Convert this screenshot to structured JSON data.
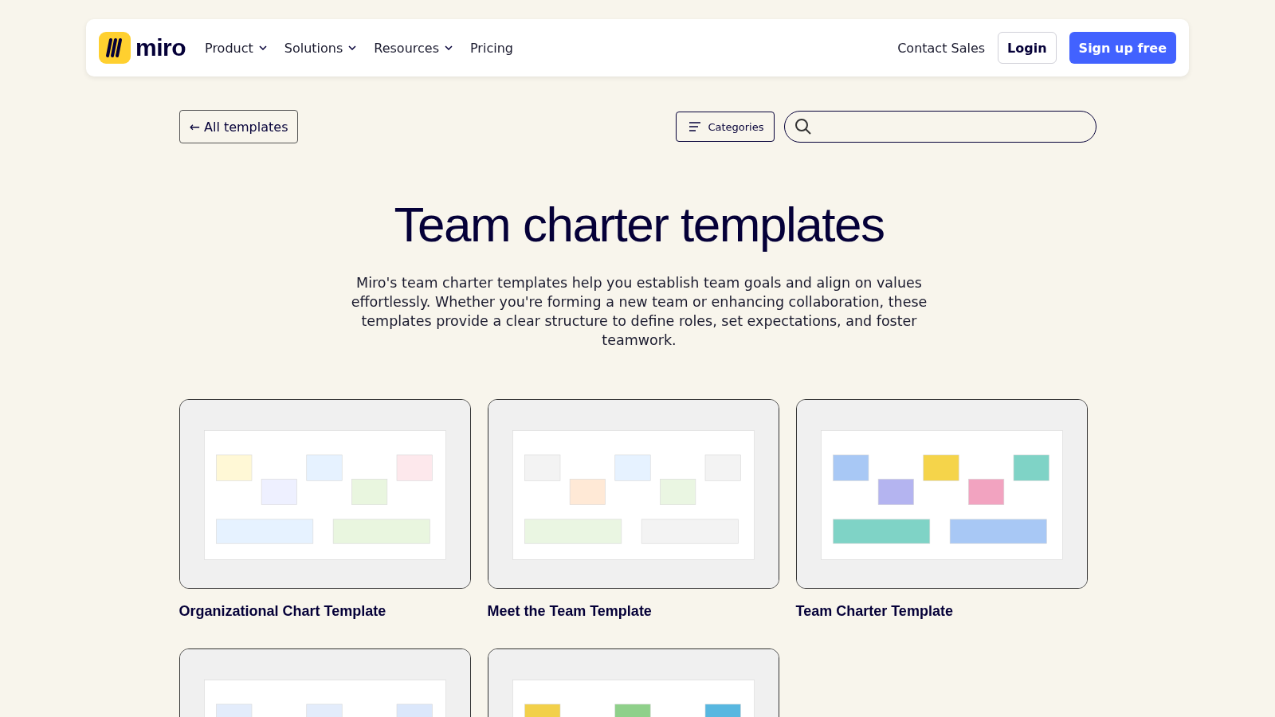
{
  "header": {
    "logo": "miro",
    "nav": [
      {
        "label": "Product",
        "has_menu": true
      },
      {
        "label": "Solutions",
        "has_menu": true
      },
      {
        "label": "Resources",
        "has_menu": true
      },
      {
        "label": "Pricing",
        "has_menu": false
      }
    ],
    "contact": "Contact Sales",
    "login": "Login",
    "signup": "Sign up free"
  },
  "toolbar": {
    "back": "← All templates",
    "categories": "Categories"
  },
  "title": "Team charter templates",
  "description": "Miro's team charter templates help you establish team goals and align on values effortlessly. Whether you're forming a new team or enhancing collaboration, these templates provide a clear structure to define roles, set expectations, and foster teamwork.",
  "templates": [
    {
      "kind": "picture",
      "title": "Organizational Chart Template"
    },
    {
      "kind": "picture",
      "title": "Meet the Team Template"
    },
    {
      "kind": "picture",
      "title": "Team Charter Template"
    },
    {
      "kind": "picture"
    },
    {
      "kind": "picture"
    }
  ]
}
